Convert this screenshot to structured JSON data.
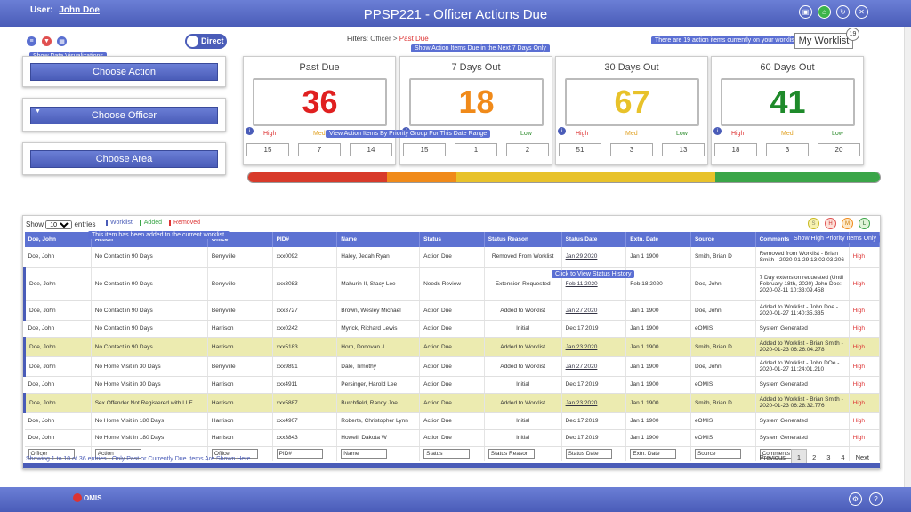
{
  "header": {
    "user_label": "User:",
    "user_name": "John Doe",
    "title": "PPSP221 - Officer Actions Due"
  },
  "header_icons": [
    "book-icon",
    "home-icon",
    "refresh-icon",
    "close-icon"
  ],
  "toolbar": {
    "tooltip_viz": "Show Data Visualizations",
    "direct_toggle": "Direct"
  },
  "filters": {
    "label": "Filters:",
    "path_1": "Officer",
    "sep": ">",
    "path_2": "Past Due",
    "tooltip": "Show Action Items Due in the Next 7 Days Only"
  },
  "worklist": {
    "banner": "There are 19 action items currently on your worklist.",
    "button": "My Worklist",
    "count": "19"
  },
  "panels": {
    "choose_action": "Choose Action",
    "choose_officer": "Choose Officer",
    "choose_area": "Choose Area"
  },
  "cards": [
    {
      "title": "Past Due",
      "value": "36",
      "color": "#e02020",
      "high": "15",
      "med": "7",
      "low": "14"
    },
    {
      "title": "7 Days Out",
      "value": "18",
      "color": "#f08a1a",
      "high": "15",
      "med": "1",
      "low": "2"
    },
    {
      "title": "30 Days Out",
      "value": "67",
      "color": "#e8c22a",
      "high": "51",
      "med": "3",
      "low": "13"
    },
    {
      "title": "60 Days Out",
      "value": "41",
      "color": "#1e8a2a",
      "high": "18",
      "med": "3",
      "low": "20"
    }
  ],
  "prio_labels": {
    "high": "High",
    "med": "Med",
    "low": "Low"
  },
  "prio_tooltip": "View Action Items By Priority Group For This Date Range",
  "table": {
    "show_label": "Show",
    "show_value": "10",
    "entries_label": "entries",
    "legend": {
      "worklist": "Worklist",
      "added": "Added",
      "removed": "Removed"
    },
    "added_tooltip": "This item has been added to the current worklist.",
    "status_tooltip": "Click to View Status History",
    "priority_tooltip": "Show High Priority Items Only",
    "priority_buttons": [
      "S",
      "H",
      "M",
      "L"
    ],
    "headers": [
      "Doe, John",
      "Action",
      "Office",
      "PID#",
      "Name",
      "Status",
      "Status Reason",
      "Status Date",
      "Extn. Date",
      "Source",
      "Comments",
      ""
    ],
    "rows": [
      {
        "officer": "Doe, John",
        "action": "No Contact in 90 Days",
        "office": "Berryville",
        "pid": "xxx0092",
        "name": "Haley, Jedah Ryan",
        "status": "Action Due",
        "reason": "Removed From Worklist",
        "sdate": "Jan 29 2020",
        "edate": "Jan 1 1900",
        "source": "Smith, Brian D",
        "comments": "Removed from Worklist - Brian Smith - 2020-01-29 13:02:03.206",
        "prio": "High"
      },
      {
        "officer": "Doe, John",
        "action": "No Contact in 90 Days",
        "office": "Berryville",
        "pid": "xxx3083",
        "name": "Mahurin II, Stacy Lee",
        "status": "Needs Review",
        "reason": "Extension Requested",
        "sdate": "Feb 11 2020",
        "edate": "Feb 18 2020",
        "source": "Doe, John",
        "comments": "7 Day extension requested (Until February 18th, 2020) John Doe: 2020-02-11 10:33:09.458",
        "prio": "High"
      },
      {
        "officer": "Doe, John",
        "action": "No Contact in 90 Days",
        "office": "Berryville",
        "pid": "xxx3727",
        "name": "Brown, Wesley Michael",
        "status": "Action Due",
        "reason": "Added to Worklist",
        "sdate": "Jan 27 2020",
        "edate": "Jan 1 1900",
        "source": "Doe, John",
        "comments": "Added to Worklist - John Doe - 2020-01-27 11:40:35.335",
        "prio": "High"
      },
      {
        "officer": "Doe, John",
        "action": "No Contact in 90 Days",
        "office": "Harrison",
        "pid": "xxx0242",
        "name": "Myrick, Richard Lewis",
        "status": "Action Due",
        "reason": "Initial",
        "sdate": "Dec 17 2019",
        "edate": "Jan 1 1900",
        "source": "eOMIS",
        "comments": "System Generated",
        "prio": "High"
      },
      {
        "officer": "Doe, John",
        "action": "No Contact in 90 Days",
        "office": "Harrison",
        "pid": "xxx5183",
        "name": "Horn, Donovan J",
        "status": "Action Due",
        "reason": "Added to Worklist",
        "sdate": "Jan 23 2020",
        "edate": "Jan 1 1900",
        "source": "Smith, Brian D",
        "comments": "Added to Worklist - Brian Smith - 2020-01-23 06:26:04.278",
        "prio": "High"
      },
      {
        "officer": "Doe, John",
        "action": "No Home Visit in 30 Days",
        "office": "Berryville",
        "pid": "xxx9891",
        "name": "Dale, Timothy",
        "status": "Action Due",
        "reason": "Added to Worklist",
        "sdate": "Jan 27 2020",
        "edate": "Jan 1 1900",
        "source": "Doe, John",
        "comments": "Added to Worklist - John DOe - 2020-01-27 11:24:01.210",
        "prio": "High"
      },
      {
        "officer": "Doe, John",
        "action": "No Home Visit in 30 Days",
        "office": "Harrison",
        "pid": "xxx4911",
        "name": "Persinger, Harold Lee",
        "status": "Action Due",
        "reason": "Initial",
        "sdate": "Dec 17 2019",
        "edate": "Jan 1 1900",
        "source": "eOMIS",
        "comments": "System Generated",
        "prio": "High"
      },
      {
        "officer": "Doe, John",
        "action": "Sex Offender Not Registered with LLE",
        "office": "Harrison",
        "pid": "xxx5887",
        "name": "Burchfield, Randy Joe",
        "status": "Action Due",
        "reason": "Added to Worklist",
        "sdate": "Jan 23 2020",
        "edate": "Jan 1 1900",
        "source": "Smith, Brian D",
        "comments": "Added to Worklist - Brian Smith - 2020-01-23 06:28:32.776",
        "prio": "High"
      },
      {
        "officer": "Doe, John",
        "action": "No Home Visit in 180 Days",
        "office": "Harrison",
        "pid": "xxx4907",
        "name": "Roberts, Christopher Lynn",
        "status": "Action Due",
        "reason": "Initial",
        "sdate": "Dec 17 2019",
        "edate": "Jan 1 1900",
        "source": "eOMIS",
        "comments": "System Generated",
        "prio": "High"
      },
      {
        "officer": "Doe, John",
        "action": "No Home Visit in 180 Days",
        "office": "Harrison",
        "pid": "xxx3843",
        "name": "Howell, Dakota W",
        "status": "Action Due",
        "reason": "Initial",
        "sdate": "Dec 17 2019",
        "edate": "Jan 1 1900",
        "source": "eOMIS",
        "comments": "System Generated",
        "prio": "High"
      }
    ],
    "filters": [
      "Officer",
      "Action",
      "Office",
      "PID#",
      "Name",
      "Status",
      "Status Reason",
      "Status Date",
      "Extn. Date",
      "Source",
      "Comments"
    ],
    "footer": "Showing 1 to 10 of 36 entries - Only Past or Currently Due Items Are Shown Here",
    "pager": {
      "previous": "Previous",
      "pages": [
        "1",
        "2",
        "3",
        "4"
      ],
      "next": "Next"
    }
  },
  "bottom": {
    "logo": "OMIS"
  },
  "colors": {
    "accent": "#4a5cb8",
    "red": "#e02020",
    "orange": "#f08a1a",
    "yellow": "#e8c22a",
    "green": "#1e8a2a"
  }
}
